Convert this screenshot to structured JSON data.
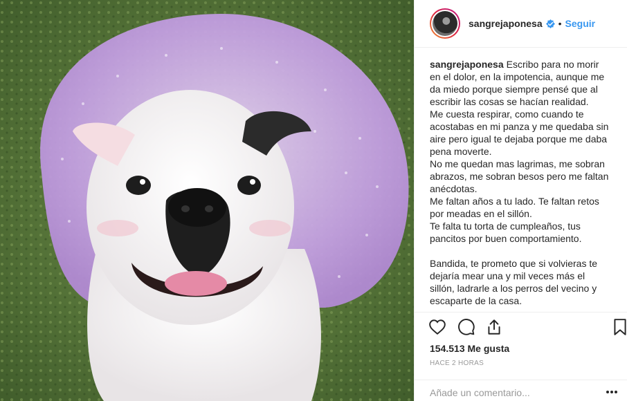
{
  "post": {
    "username": "sangrejaponesa",
    "verified": true,
    "separator": "•",
    "follow_label": "Seguir",
    "caption": {
      "author": "sangrejaponesa",
      "paragraphs": [
        "Escribo para no morir en el dolor, en la impotencia, aunque me da miedo porque siempre pensé que al escribir las cosas se hacían realidad.",
        "Me cuesta respirar, como cuando te acostabas en mi panza y me quedaba sin aire pero igual te dejaba porque me daba pena moverte.",
        "No me quedan mas lagrimas, me sobran abrazos, me sobran besos pero me faltan anécdotas.",
        "Me faltan años a tu lado. Te faltan retos por meadas en el sillón.",
        "Te falta tu torta de cumpleaños, tus pancitos por buen comportamiento.",
        "Bandida, te prometo que si volvieras te dejaría mear una y mil veces más el sillón, ladrarle a los perros del vecino y escaparte de la casa."
      ]
    },
    "icons": [
      "heart-icon",
      "comment-icon",
      "share-icon",
      "bookmark-icon"
    ],
    "likes": "154.513 Me gusta",
    "time": "HACE 2 HORAS",
    "comment_placeholder": "Añade un comentario...",
    "more_label": "...",
    "colors": {
      "link": "#3897f0",
      "text": "#262626",
      "muted": "#999999",
      "border": "#efefef",
      "tutu": "#c9a3e8"
    }
  }
}
